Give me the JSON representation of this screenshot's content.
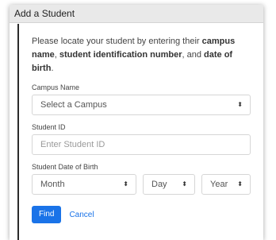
{
  "dialog": {
    "title": "Add a Student",
    "intro": {
      "part1": "Please locate your student by entering their ",
      "bold1": "campus name",
      "part2": ", ",
      "bold2": "student identification number",
      "part3": ", and ",
      "bold3": "date of birth",
      "part4": "."
    },
    "campus": {
      "label": "Campus Name",
      "selected": "Select a Campus"
    },
    "student_id": {
      "label": "Student ID",
      "placeholder": "Enter Student ID"
    },
    "dob": {
      "label": "Student Date of Birth",
      "month": "Month",
      "day": "Day",
      "year": "Year"
    },
    "actions": {
      "find": "Find",
      "cancel": "Cancel"
    },
    "colors": {
      "accent": "#1a73e8"
    }
  }
}
